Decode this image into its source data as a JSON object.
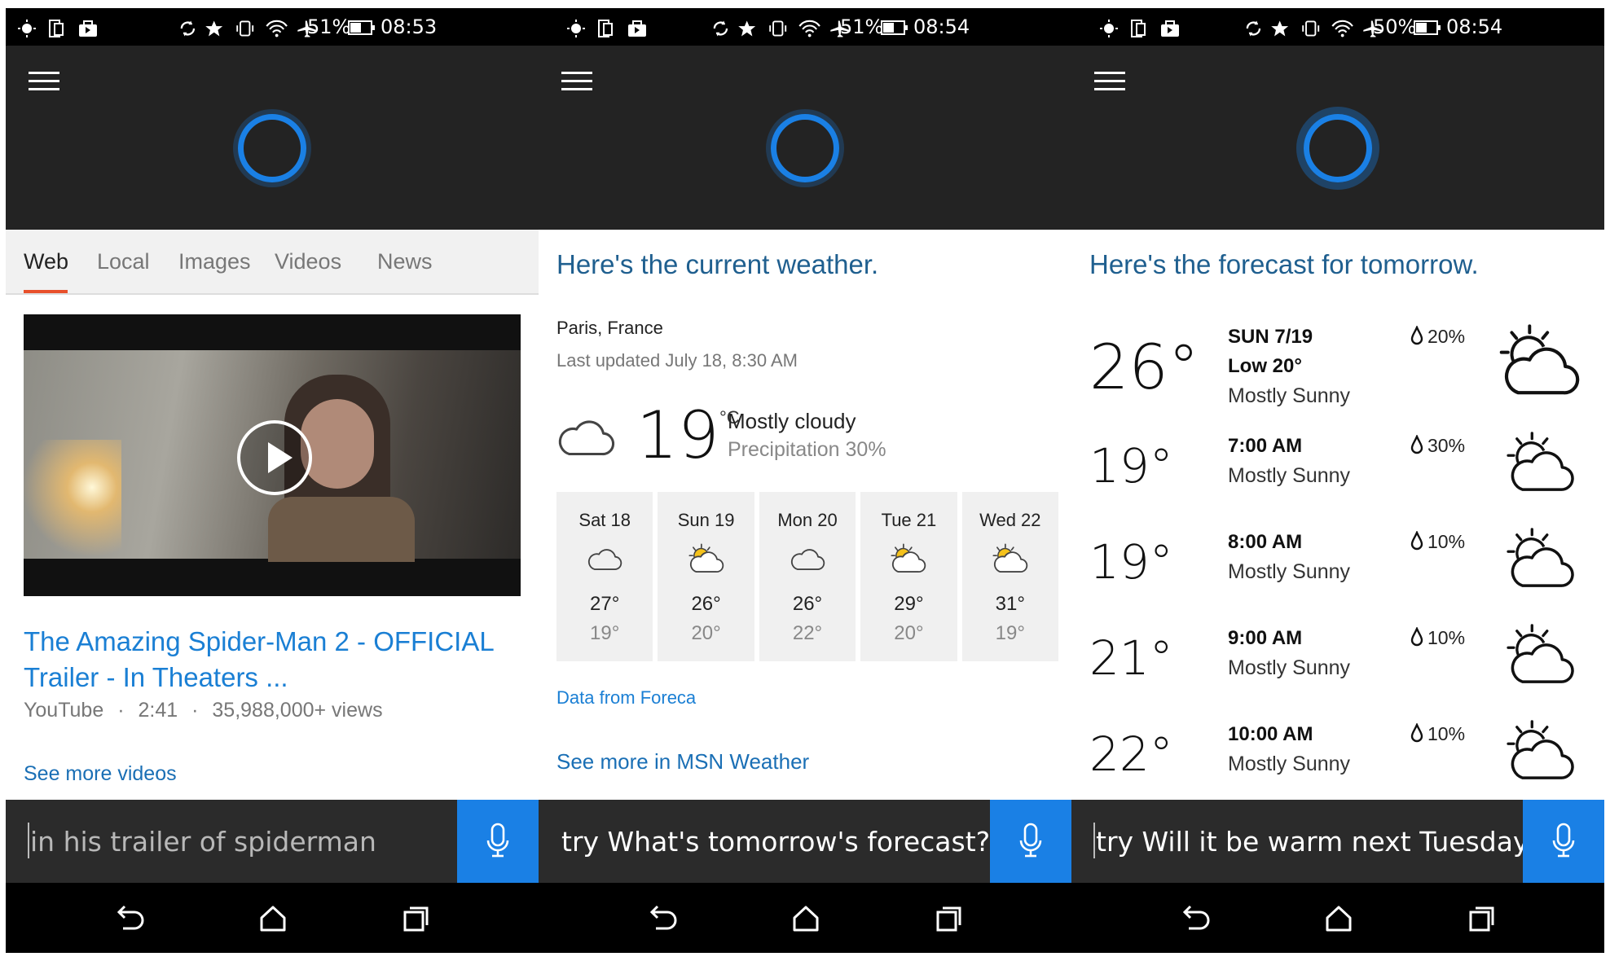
{
  "colors": {
    "accent": "#1a80e5",
    "header_bg": "#232323",
    "query_bg": "#2b2b2b",
    "tab_underline": "#e8502b",
    "link": "#1a7fd4"
  },
  "panels": [
    {
      "status": {
        "battery": "51%",
        "time": "08:53"
      },
      "tabs": [
        "Web",
        "Local",
        "Images",
        "Videos",
        "News"
      ],
      "active_tab": "Web",
      "video": {
        "title": "The Amazing Spider-Man 2 - OFFICIAL Trailer - In Theaters ...",
        "source": "YouTube",
        "duration": "2:41",
        "views": "35,988,000+ views",
        "sep": "·"
      },
      "see_more": "See more videos",
      "query": "in his trailer of spiderman"
    },
    {
      "status": {
        "battery": "51%",
        "time": "08:54"
      },
      "heading": "Here's the current weather.",
      "location": "Paris, France",
      "updated": "Last updated July 18, 8:30 AM",
      "current": {
        "temp": "19",
        "unit": "°C",
        "condition": "Mostly cloudy",
        "precipitation": "Precipitation 30%",
        "icon": "cloud-icon"
      },
      "days": [
        {
          "name": "Sat 18",
          "hi": "27°",
          "lo": "19°",
          "icon": "cloud-icon"
        },
        {
          "name": "Sun 19",
          "hi": "26°",
          "lo": "20°",
          "icon": "partly-sunny-icon"
        },
        {
          "name": "Mon 20",
          "hi": "26°",
          "lo": "22°",
          "icon": "cloud-icon"
        },
        {
          "name": "Tue 21",
          "hi": "29°",
          "lo": "20°",
          "icon": "partly-sunny-icon"
        },
        {
          "name": "Wed 22",
          "hi": "31°",
          "lo": "19°",
          "icon": "partly-sunny-icon"
        }
      ],
      "data_source": "Data from Foreca",
      "see_more": "See more in MSN Weather",
      "query": "try What's tomorrow's forecast?"
    },
    {
      "status": {
        "battery": "50%",
        "time": "08:54"
      },
      "heading": "Here's the forecast for tomorrow.",
      "summary": {
        "temp": "26°",
        "date": "SUN 7/19",
        "low": "Low 20°",
        "desc": "Mostly Sunny",
        "precip": "20%"
      },
      "hours": [
        {
          "temp": "19°",
          "time": "7:00 AM",
          "desc": "Mostly Sunny",
          "precip": "30%"
        },
        {
          "temp": "19°",
          "time": "8:00 AM",
          "desc": "Mostly Sunny",
          "precip": "10%"
        },
        {
          "temp": "21°",
          "time": "9:00 AM",
          "desc": "Mostly Sunny",
          "precip": "10%"
        },
        {
          "temp": "22°",
          "time": "10:00 AM",
          "desc": "Mostly Sunny",
          "precip": "10%"
        }
      ],
      "query": "try Will it be warm next Tuesday?"
    }
  ]
}
